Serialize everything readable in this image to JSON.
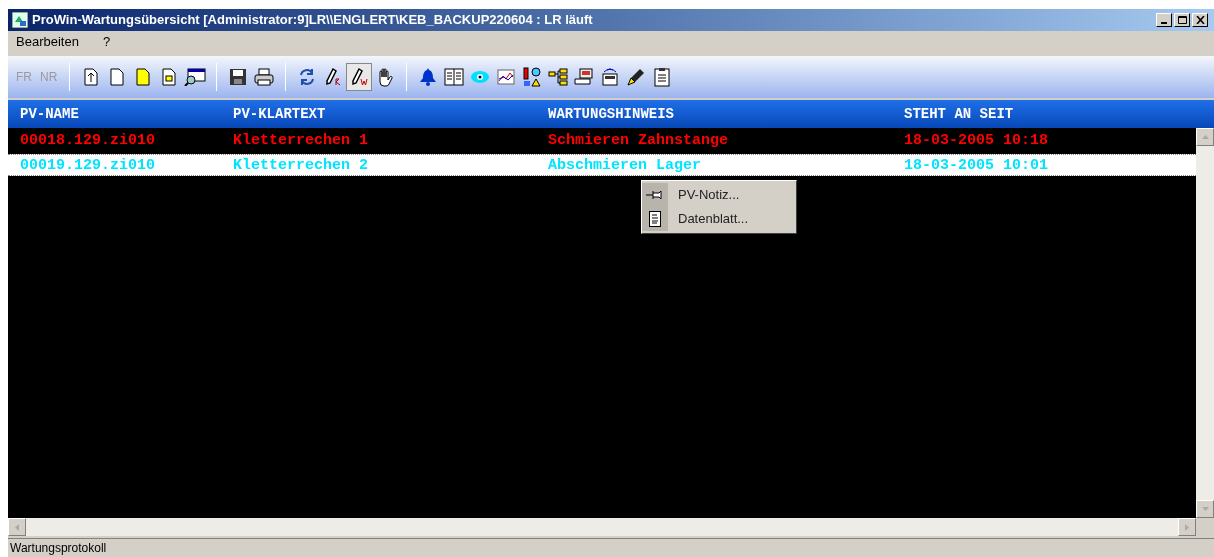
{
  "window": {
    "title": "ProWin-Wartungsübersicht [Administrator:9]LR\\\\ENGLERT\\KEB_BACKUP220604 : LR läuft"
  },
  "menu": [
    {
      "label": "Bearbeiten"
    },
    {
      "label": "?"
    }
  ],
  "toolbar": {
    "text_buttons": [
      {
        "label": "FR",
        "disabled": true
      },
      {
        "label": "NR",
        "disabled": true
      }
    ],
    "groups": [
      [
        {
          "pressed": false
        },
        {
          "pressed": false
        },
        {
          "pressed": false
        },
        {
          "pressed": false
        },
        {
          "pressed": false
        }
      ],
      [
        {
          "pressed": false
        },
        {
          "pressed": false
        }
      ],
      [
        {
          "pressed": false
        },
        {
          "pressed": false
        },
        {
          "pressed": true
        },
        {
          "pressed": false
        }
      ],
      [
        {
          "pressed": false
        },
        {
          "pressed": false
        },
        {
          "pressed": false
        },
        {
          "pressed": false
        },
        {
          "pressed": false
        },
        {
          "pressed": false
        },
        {
          "pressed": false
        },
        {
          "pressed": false
        },
        {
          "pressed": false
        },
        {
          "pressed": false
        }
      ]
    ]
  },
  "table": {
    "columns": [
      "PV-NAME",
      "PV-KLARTEXT",
      "WARTUNGSHINWEIS",
      "STEHT AN SEIT"
    ],
    "rows": [
      {
        "cells": [
          "00018.129.zi010",
          "Kletterrechen 1",
          "Schmieren Zahnstange",
          "18-03-2005 10:18"
        ],
        "color": "#ff0000",
        "selected": false
      },
      {
        "cells": [
          "00019.129.zi010",
          "Kletterrechen 2",
          "Abschmieren Lager",
          "18-03-2005 10:01"
        ],
        "color": "#00e5ff",
        "selected": true
      }
    ]
  },
  "context_menu": {
    "items": [
      {
        "label": "PV-Notiz..."
      },
      {
        "label": "Datenblatt..."
      }
    ]
  },
  "status_bar": {
    "text": "Wartungsprotokoll"
  }
}
